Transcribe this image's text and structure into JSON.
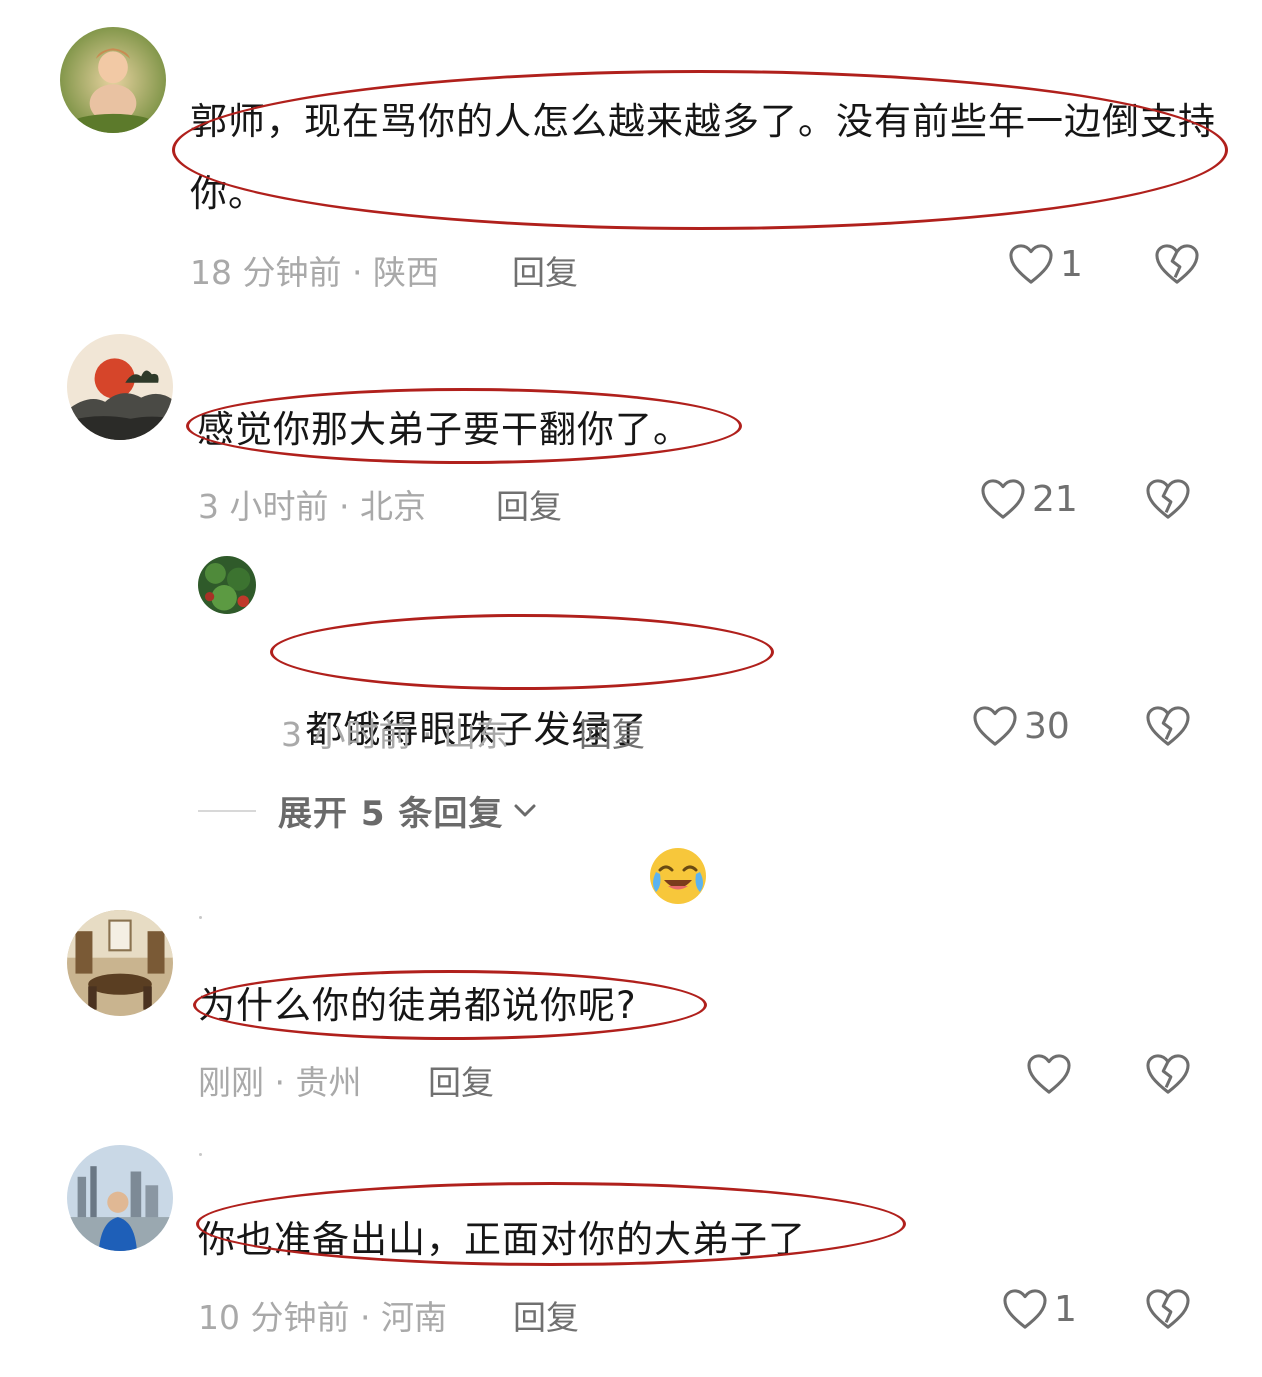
{
  "comments": [
    {
      "text": "郭师，现在骂你的人怎么越来越多了。没有前些年一边倒支持你。",
      "time": "18 分钟前 · 陕西",
      "reply_label": "回复",
      "likes": "1",
      "avatar": "avatar-child-photo"
    },
    {
      "text": "感觉你那大弟子要干翻你了。",
      "time": "3 小时前 · 北京",
      "reply_label": "回复",
      "likes": "21",
      "avatar": "avatar-sunset-painting",
      "replies": [
        {
          "text": "都饿得眼珠子发绿了",
          "emoji": "crying-laughing-emoji",
          "time": "3 小时前 · 山东",
          "reply_label": "回复",
          "likes": "30",
          "avatar": "avatar-green-leaves"
        }
      ],
      "expand_label": "展开 5 条回复"
    },
    {
      "text": "为什么你的徒弟都说你呢?",
      "time": "刚刚 · 贵州",
      "reply_label": "回复",
      "likes": "",
      "avatar": "avatar-interior-room"
    },
    {
      "text": "你也准备出山，正面对你的大弟子了",
      "time": "10 分钟前 · 河南",
      "reply_label": "回复",
      "likes": "1",
      "avatar": "avatar-city-person"
    }
  ],
  "colors": {
    "highlight": "#b0201c",
    "meta_gray": "#a9a9a9",
    "reply_gray": "#707070"
  }
}
